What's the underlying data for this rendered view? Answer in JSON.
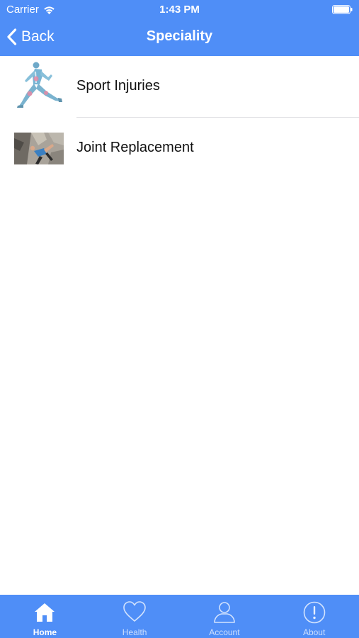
{
  "status_bar": {
    "carrier": "Carrier",
    "time": "1:43 PM"
  },
  "nav": {
    "back_label": "Back",
    "title": "Speciality"
  },
  "list": {
    "items": [
      {
        "label": "Sport Injuries",
        "thumbnail": "runner-anatomy-image"
      },
      {
        "label": "Joint Replacement",
        "thumbnail": "climber-photo-image"
      }
    ]
  },
  "tabbar": {
    "active": "Home",
    "tabs": [
      {
        "label": "Home",
        "icon": "home-icon"
      },
      {
        "label": "Health",
        "icon": "heart-icon"
      },
      {
        "label": "Account",
        "icon": "user-icon"
      },
      {
        "label": "About",
        "icon": "info-icon"
      }
    ]
  },
  "colors": {
    "accent": "#4f8ef7",
    "separator": "#e0e0e3",
    "text": "#111111"
  }
}
